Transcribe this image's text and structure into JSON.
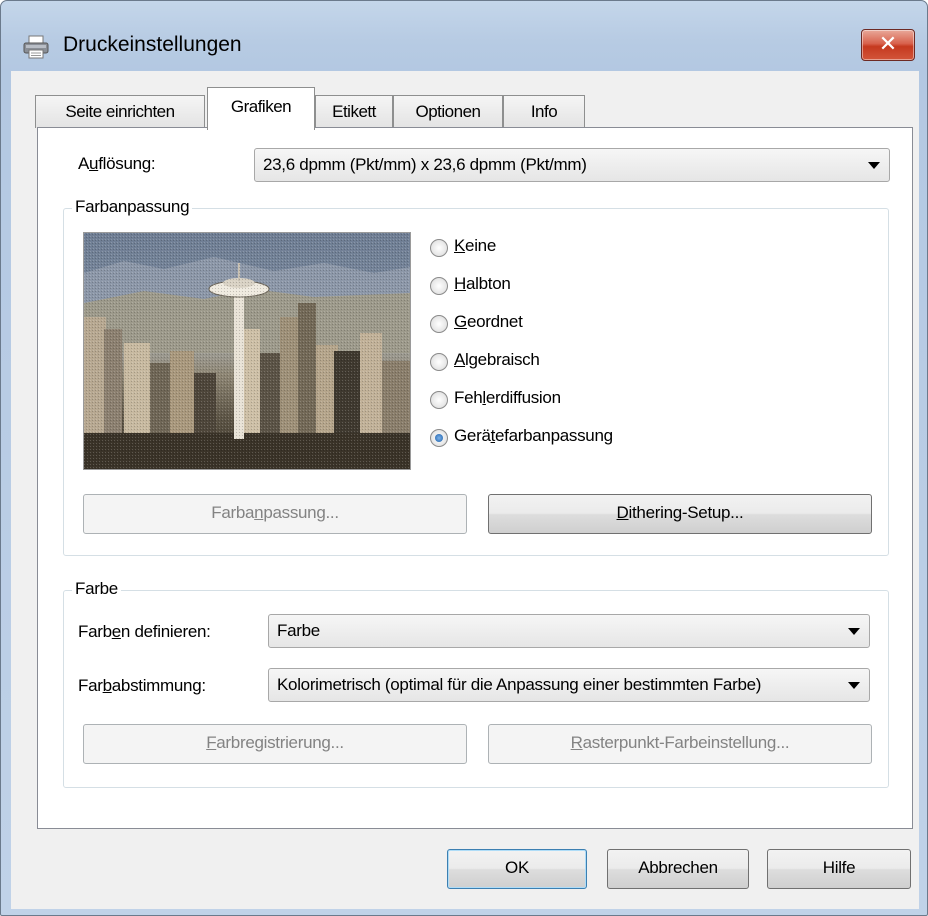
{
  "window": {
    "title": "Druckeinstellungen"
  },
  "tabs": [
    "Seite einrichten",
    "Grafiken",
    "Etikett",
    "Optionen",
    "Info"
  ],
  "resolution": {
    "label_pre": "A",
    "label_key": "u",
    "label_post": "flösung:",
    "value": "23,6 dpmm (Pkt/mm) x 23,6 dpmm (Pkt/mm)"
  },
  "color_matching": {
    "group_title": "Farbanpassung",
    "options": [
      {
        "pre": "",
        "key": "K",
        "post": "eine",
        "selected": false
      },
      {
        "pre": "",
        "key": "H",
        "post": "albton",
        "selected": false
      },
      {
        "pre": "",
        "key": "G",
        "post": "eordnet",
        "selected": false
      },
      {
        "pre": "",
        "key": "A",
        "post": "lgebraisch",
        "selected": false
      },
      {
        "pre": "Feh",
        "key": "l",
        "post": "erdiffusion",
        "selected": false
      },
      {
        "pre": "Gerä",
        "key": "t",
        "post": "efarbanpassung",
        "selected": true
      }
    ],
    "btn_farbanpassung": {
      "pre": "Farba",
      "key": "n",
      "post": "passung..."
    },
    "btn_dithering": {
      "pre": "",
      "key": "D",
      "post": "ithering-Setup..."
    }
  },
  "color": {
    "group_title": "Farbe",
    "define_label": {
      "pre": "Farb",
      "key": "e",
      "post": "n definieren:"
    },
    "define_value": "Farbe",
    "match_label": {
      "pre": "Far",
      "key": "b",
      "post": "abstimmung:"
    },
    "match_value": "Kolorimetrisch (optimal für die Anpassung einer bestimmten Farbe)",
    "btn_registration": {
      "pre": "",
      "key": "F",
      "post": "arbregistrierung..."
    },
    "btn_raster": {
      "pre": "",
      "key": "R",
      "post": "asterpunkt-Farbeinstellung..."
    }
  },
  "buttons": {
    "ok": "OK",
    "cancel": "Abbrechen",
    "help": "Hilfe"
  }
}
